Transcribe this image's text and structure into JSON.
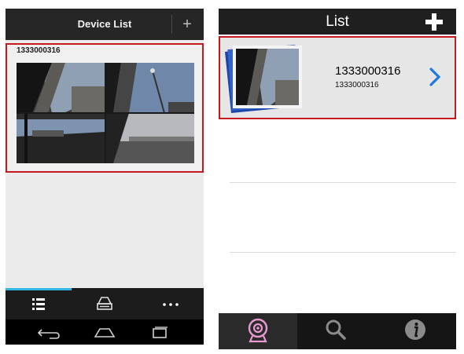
{
  "left_screen": {
    "header": {
      "title": "Device List",
      "add_label": "+"
    },
    "device": {
      "id": "1333000316"
    },
    "camera_overlays": [
      "",
      "",
      "",
      ""
    ],
    "tabs": [
      {
        "name": "list",
        "icon": "list-icon",
        "active": true
      },
      {
        "name": "dvr",
        "icon": "dvr-icon",
        "active": false
      },
      {
        "name": "more",
        "icon": "more-icon",
        "active": false
      }
    ],
    "accent_color": "#33b5e5",
    "highlight_color": "#c7181e"
  },
  "right_screen": {
    "header": {
      "title": "List"
    },
    "device": {
      "name": "1333000316",
      "id": "1333000316"
    },
    "tabs": [
      {
        "name": "camera",
        "icon": "webcam-icon",
        "active": true
      },
      {
        "name": "search",
        "icon": "search-icon",
        "active": false
      },
      {
        "name": "info",
        "icon": "info-icon",
        "active": false
      }
    ],
    "chevron_color": "#1e7ae0"
  }
}
